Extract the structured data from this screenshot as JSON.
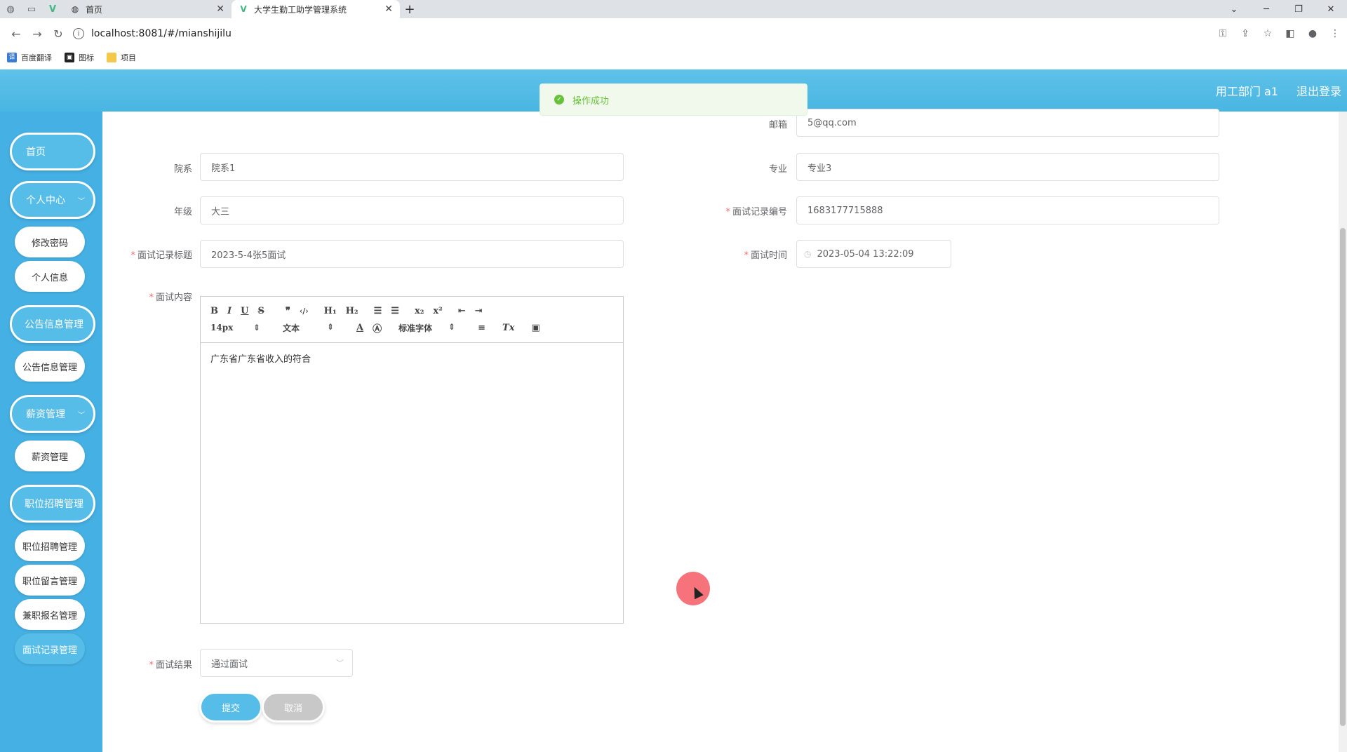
{
  "browser": {
    "tabs": [
      {
        "label": "首页",
        "favicon": "globe-icon"
      },
      {
        "label": "大学生勤工助学管理系统",
        "favicon": "vue-icon"
      }
    ],
    "url": "localhost:8081/#/mianshijilu",
    "bookmarks": [
      "百度翻译",
      "图标",
      "项目"
    ]
  },
  "header": {
    "user": "用工部门 a1",
    "logout": "退出登录"
  },
  "toast": {
    "message": "操作成功"
  },
  "sidebar": {
    "home": "首页",
    "personal_center": "个人中心",
    "change_password": "修改密码",
    "personal_info": "个人信息",
    "announcement_group": "公告信息管理",
    "announcement": "公告信息管理",
    "salary_group": "薪资管理",
    "salary": "薪资管理",
    "recruit_group": "职位招聘管理",
    "recruit": "职位招聘管理",
    "message": "职位留言管理",
    "parttime": "兼职报名管理",
    "interview": "面试记录管理"
  },
  "form": {
    "email_label": "邮箱",
    "email_value": "5@qq.com",
    "department_label": "院系",
    "department_value": "院系1",
    "major_label": "专业",
    "major_value": "专业3",
    "grade_label": "年级",
    "grade_value": "大三",
    "record_no_label": "面试记录编号",
    "record_no_value": "1683177715888",
    "record_title_label": "面试记录标题",
    "record_title_value": "2023-5-4张5面试",
    "time_label": "面试时间",
    "time_value": "2023-05-04 13:22:09",
    "content_label": "面试内容",
    "editor": {
      "font_size": "14px",
      "header_select": "文本",
      "font_family": "标准字体",
      "text": "广东省广东省收入的符合"
    },
    "result_label": "面试结果",
    "result_value": "通过面试",
    "submit": "提交",
    "cancel": "取消"
  },
  "colors": {
    "header": "#49b5e2",
    "sidebar": "#45b0e3",
    "success": "#67c23a",
    "required": "#f56c6c"
  }
}
